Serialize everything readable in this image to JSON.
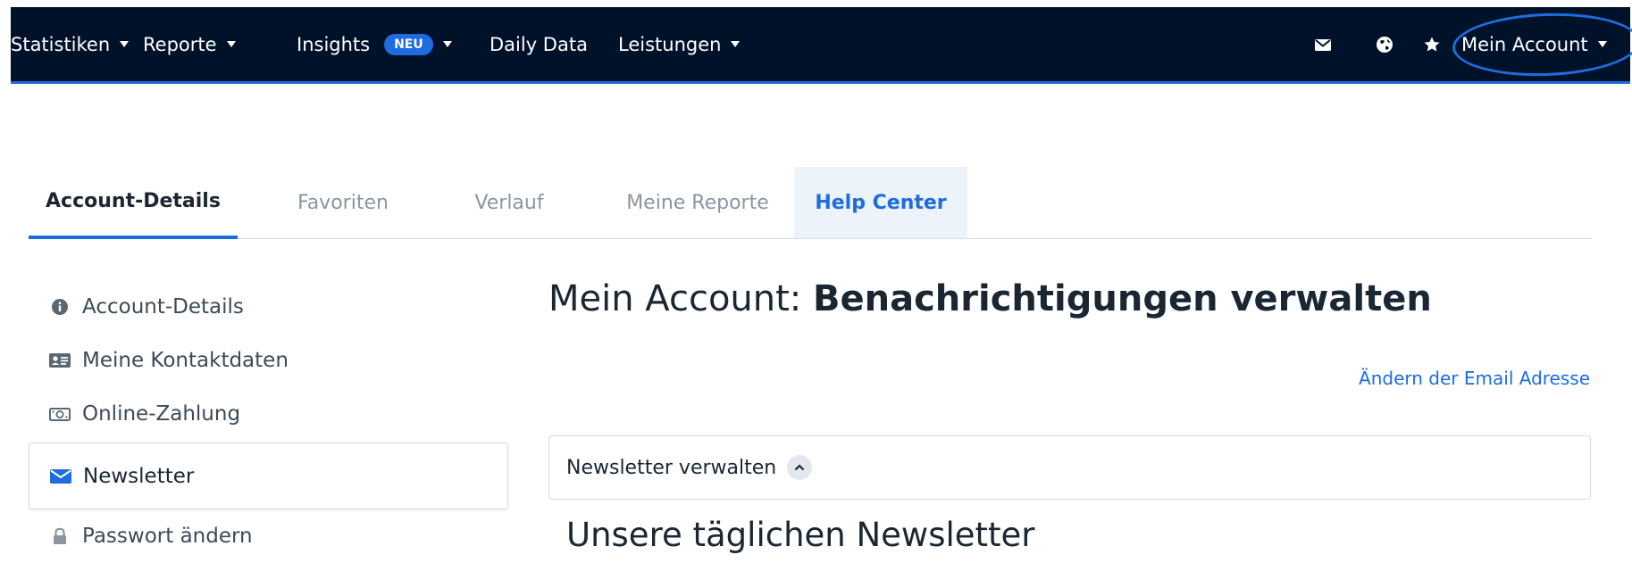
{
  "topnav": {
    "items": [
      {
        "label": "Statistiken"
      },
      {
        "label": "Reporte"
      },
      {
        "label": "Insights",
        "badge": "NEU"
      },
      {
        "label": "Daily Data"
      },
      {
        "label": "Leistungen"
      }
    ],
    "icons": [
      "mail-icon",
      "globe-icon",
      "star-icon"
    ],
    "account_label": "Mein Account",
    "colors": {
      "background": "#00112a",
      "accent": "#1d6ce0"
    }
  },
  "tabs": [
    {
      "label": "Account-Details",
      "state": "active"
    },
    {
      "label": "Favoriten"
    },
    {
      "label": "Verlauf"
    },
    {
      "label": "Meine Reporte"
    },
    {
      "label": "Help Center",
      "state": "highlighted"
    }
  ],
  "sidebar": {
    "items": [
      {
        "label": "Account-Details",
        "icon": "info-icon"
      },
      {
        "label": "Meine Kontaktdaten",
        "icon": "contact-card-icon"
      },
      {
        "label": "Online-Zahlung",
        "icon": "money-icon"
      },
      {
        "label": "Newsletter",
        "icon": "envelope-icon",
        "active": true
      },
      {
        "label": "Passwort ändern",
        "icon": "lock-icon"
      }
    ]
  },
  "main": {
    "title_prefix": "Mein Account:",
    "title_strong": "Benachrichtigungen verwalten",
    "change_email_link": "Ändern der Email Adresse",
    "accordion_label": "Newsletter verwalten",
    "section_heading": "Unsere täglichen Newsletter"
  }
}
